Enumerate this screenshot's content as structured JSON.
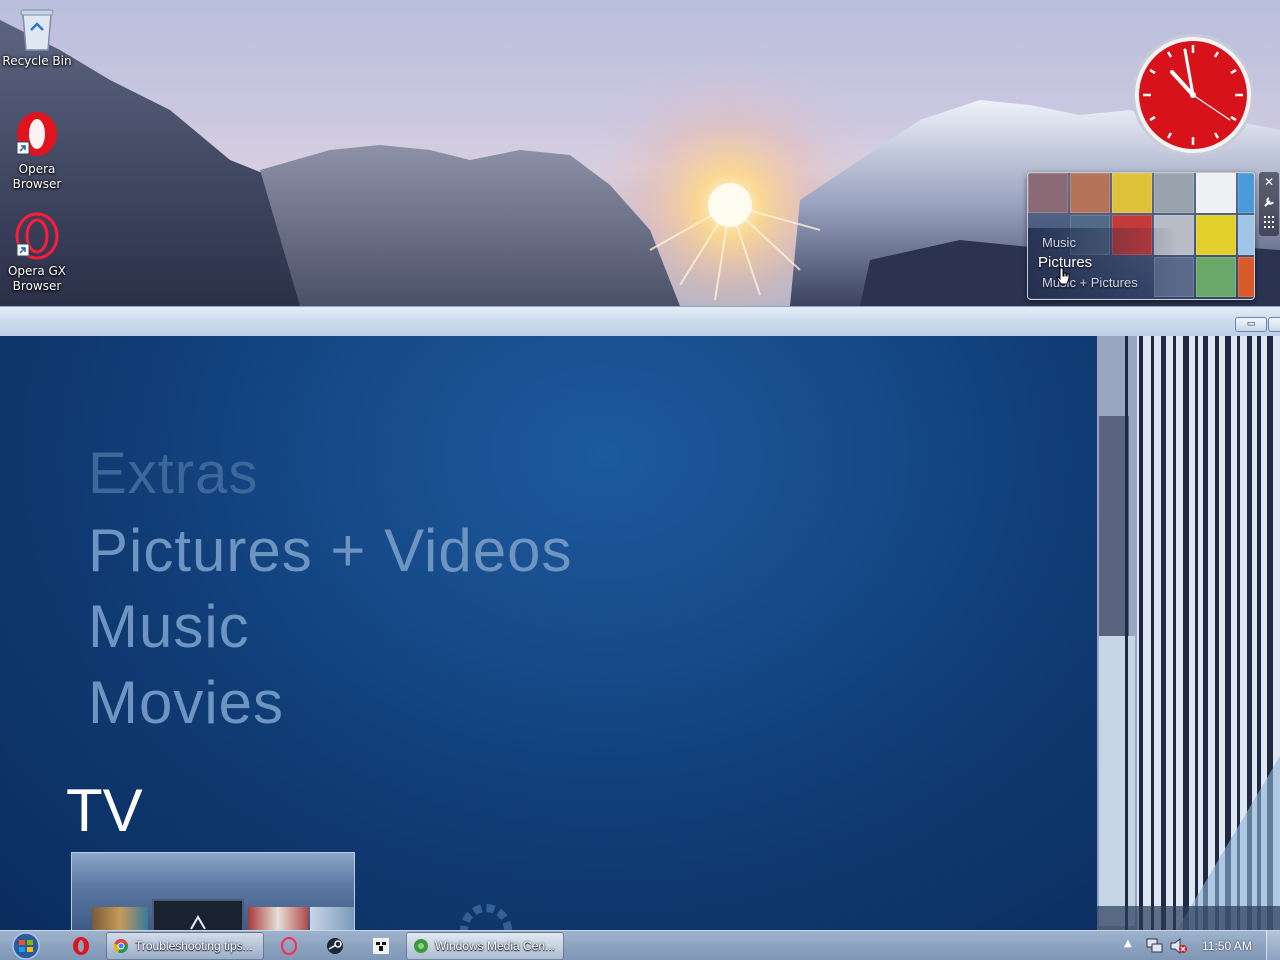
{
  "desktop": {
    "icons": [
      {
        "label": "Recycle Bin",
        "icon": "recycle-bin-icon"
      },
      {
        "label": "Opera Browser",
        "icon": "opera-icon"
      },
      {
        "label": "Opera GX Browser",
        "icon": "opera-gx-icon"
      }
    ]
  },
  "clock_gadget": {
    "time_shown": "11:50"
  },
  "media_center_gadget": {
    "items": [
      "Music",
      "Pictures",
      "Music + Pictures"
    ],
    "selected": "Pictures"
  },
  "gadget_controls": {
    "close": "✕",
    "options": "options-wrench-icon",
    "drag": "drag-grip-icon"
  },
  "window": {
    "minimize": "▭"
  },
  "media_center": {
    "menu": [
      {
        "label": "Extras",
        "color": "#3d6798"
      },
      {
        "label": "Pictures + Videos",
        "color": "#6e94c2"
      },
      {
        "label": "Music",
        "color": "#6e94c2"
      },
      {
        "label": "Movies",
        "color": "#6e94c2"
      }
    ],
    "current_section": "TV"
  },
  "taskbar": {
    "buttons": [
      {
        "label": "Troubleshooting tips...",
        "icon": "chrome-icon"
      },
      {
        "label": "Windows Media Cen...",
        "icon": "windows-media-center-icon"
      }
    ],
    "pinned": [
      "opera-icon",
      "opera-gx-icon",
      "steam-icon",
      "minecraft-icon"
    ],
    "tray": {
      "clock": "11:50 AM"
    }
  },
  "colors": {
    "accent": "#164b8a",
    "clock_face": "#d8121b"
  }
}
